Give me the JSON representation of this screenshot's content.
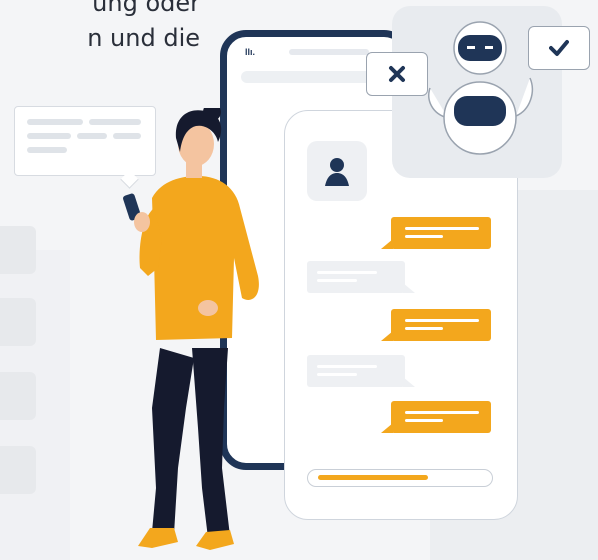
{
  "intro": {
    "line1": "ung oder",
    "line2": "n und die"
  },
  "phone": {
    "status": "llı."
  },
  "colors": {
    "accent": "#f3a71d",
    "navy": "#1f3557",
    "panel": "#e8ebef"
  },
  "icons": {
    "reject": "close-icon",
    "approve": "checkmark-icon",
    "contact": "user-silhouette-icon",
    "assistant": "robot-icon"
  },
  "chat": {
    "send_progress_percent": 60
  }
}
